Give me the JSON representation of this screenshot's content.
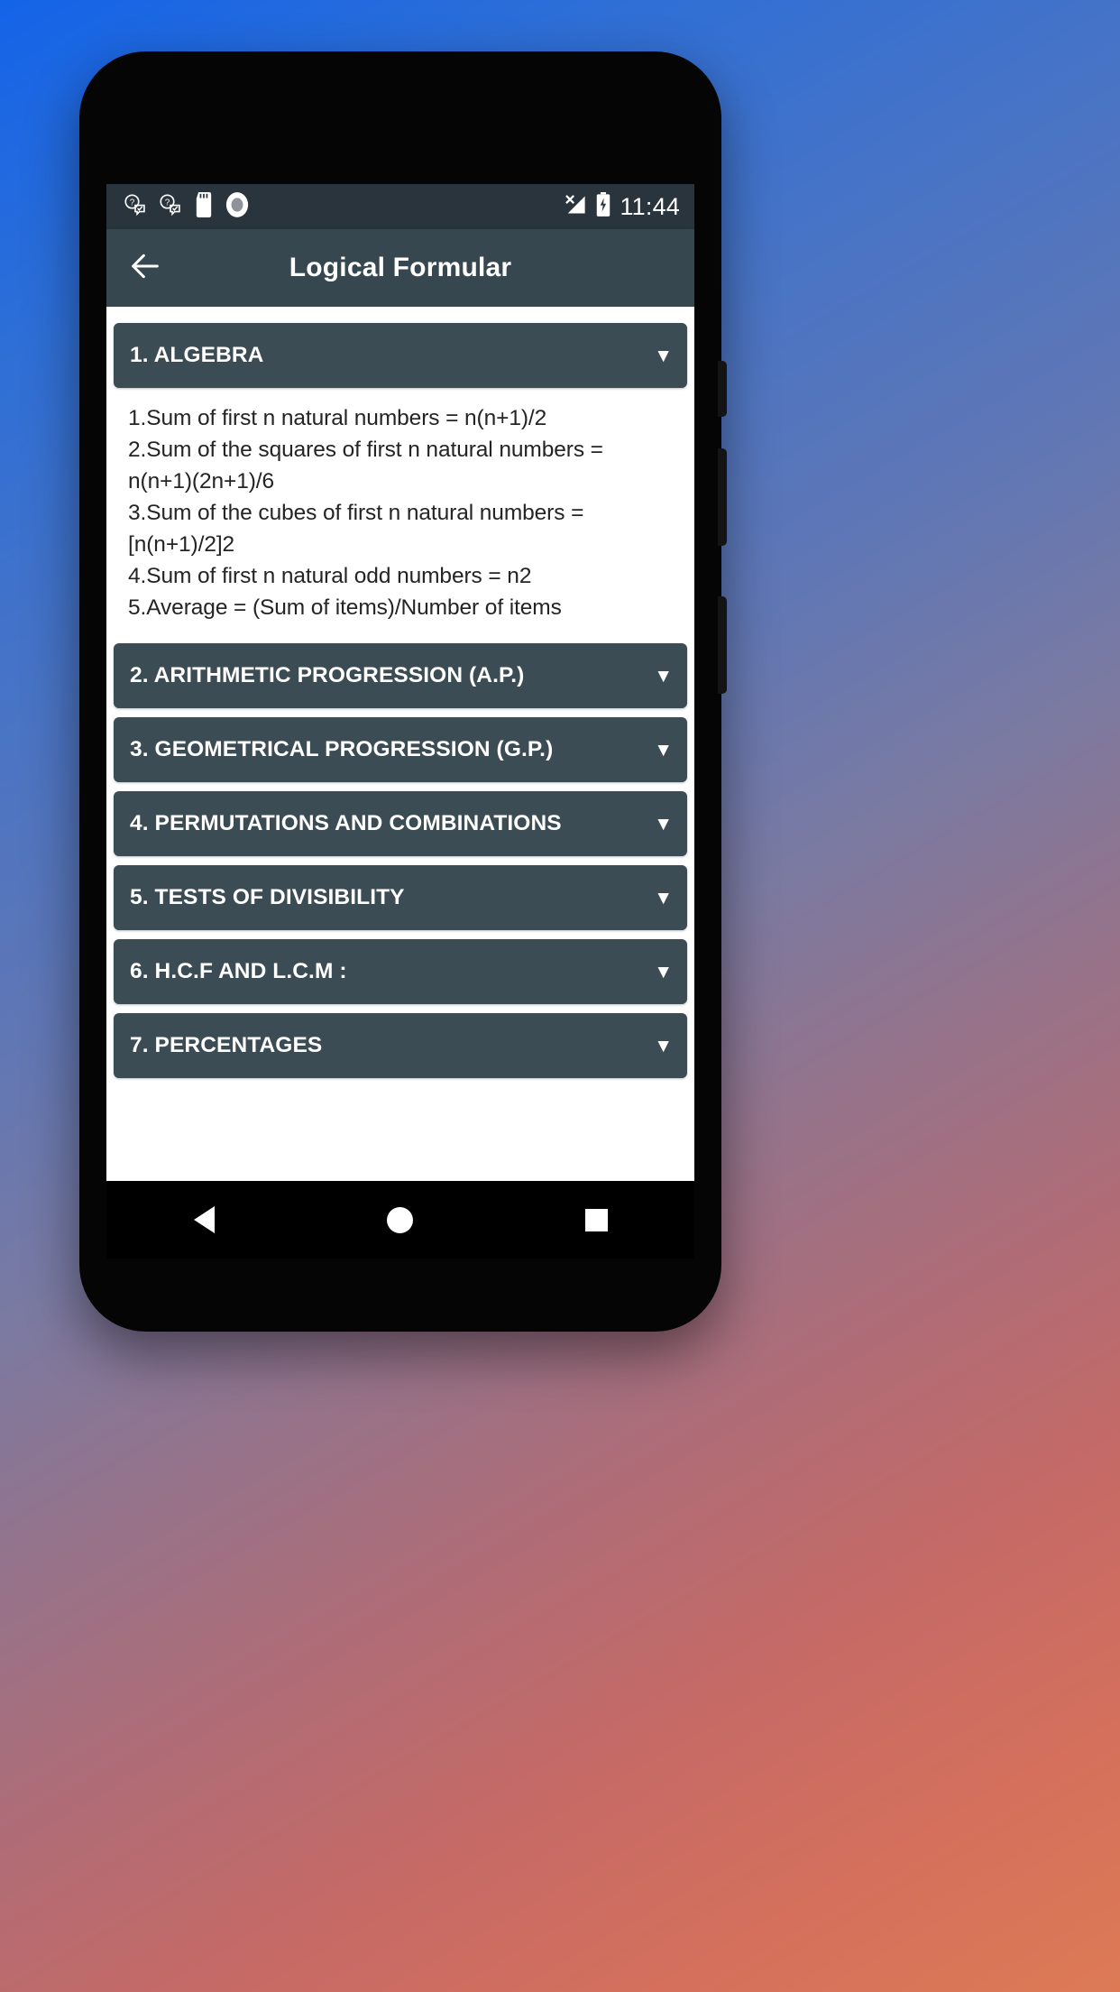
{
  "status_bar": {
    "icons": [
      {
        "name": "message-check-icon-1",
        "glyph": "?"
      },
      {
        "name": "message-check-icon-2",
        "glyph": "?"
      },
      {
        "name": "sd-card-icon",
        "glyph": ""
      },
      {
        "name": "record-circle-icon",
        "glyph": ""
      }
    ],
    "signal": "no-signal",
    "battery": "charging",
    "clock": "11:44"
  },
  "app_bar": {
    "back_label": "←",
    "title": "Logical Formular"
  },
  "theme": {
    "app_bar_bg": "#37474f",
    "status_bar_bg": "#29343c",
    "section_header_bg": "#3c4c54",
    "section_text": "#ffffff",
    "body_text": "#242424",
    "page_bg": "#ffffff"
  },
  "sections": [
    {
      "title": "1. ALGEBRA",
      "caret": "▼",
      "expanded": true,
      "body": "1.Sum of first n natural numbers = n(n+1)/2\n2.Sum of the squares of first n natural numbers = n(n+1)(2n+1)/6\n3.Sum of the cubes of first n natural numbers = [n(n+1)/2]2\n4.Sum of first n natural odd numbers = n2\n5.Average = (Sum of items)/Number of items"
    },
    {
      "title": "2. ARITHMETIC PROGRESSION (A.P.)",
      "caret": "▼",
      "expanded": false,
      "body": ""
    },
    {
      "title": "3. GEOMETRICAL PROGRESSION (G.P.)",
      "caret": "▼",
      "expanded": false,
      "body": ""
    },
    {
      "title": "4. PERMUTATIONS AND COMBINATIONS",
      "caret": "▼",
      "expanded": false,
      "body": ""
    },
    {
      "title": "5. TESTS OF DIVISIBILITY",
      "caret": "▼",
      "expanded": false,
      "body": ""
    },
    {
      "title": "6. H.C.F AND L.C.M :",
      "caret": "▼",
      "expanded": false,
      "body": ""
    },
    {
      "title": "7. PERCENTAGES",
      "caret": "▼",
      "expanded": false,
      "body": ""
    }
  ],
  "nav_bar": {
    "back": "back-triangle",
    "home": "home-circle",
    "recents": "recents-square"
  }
}
